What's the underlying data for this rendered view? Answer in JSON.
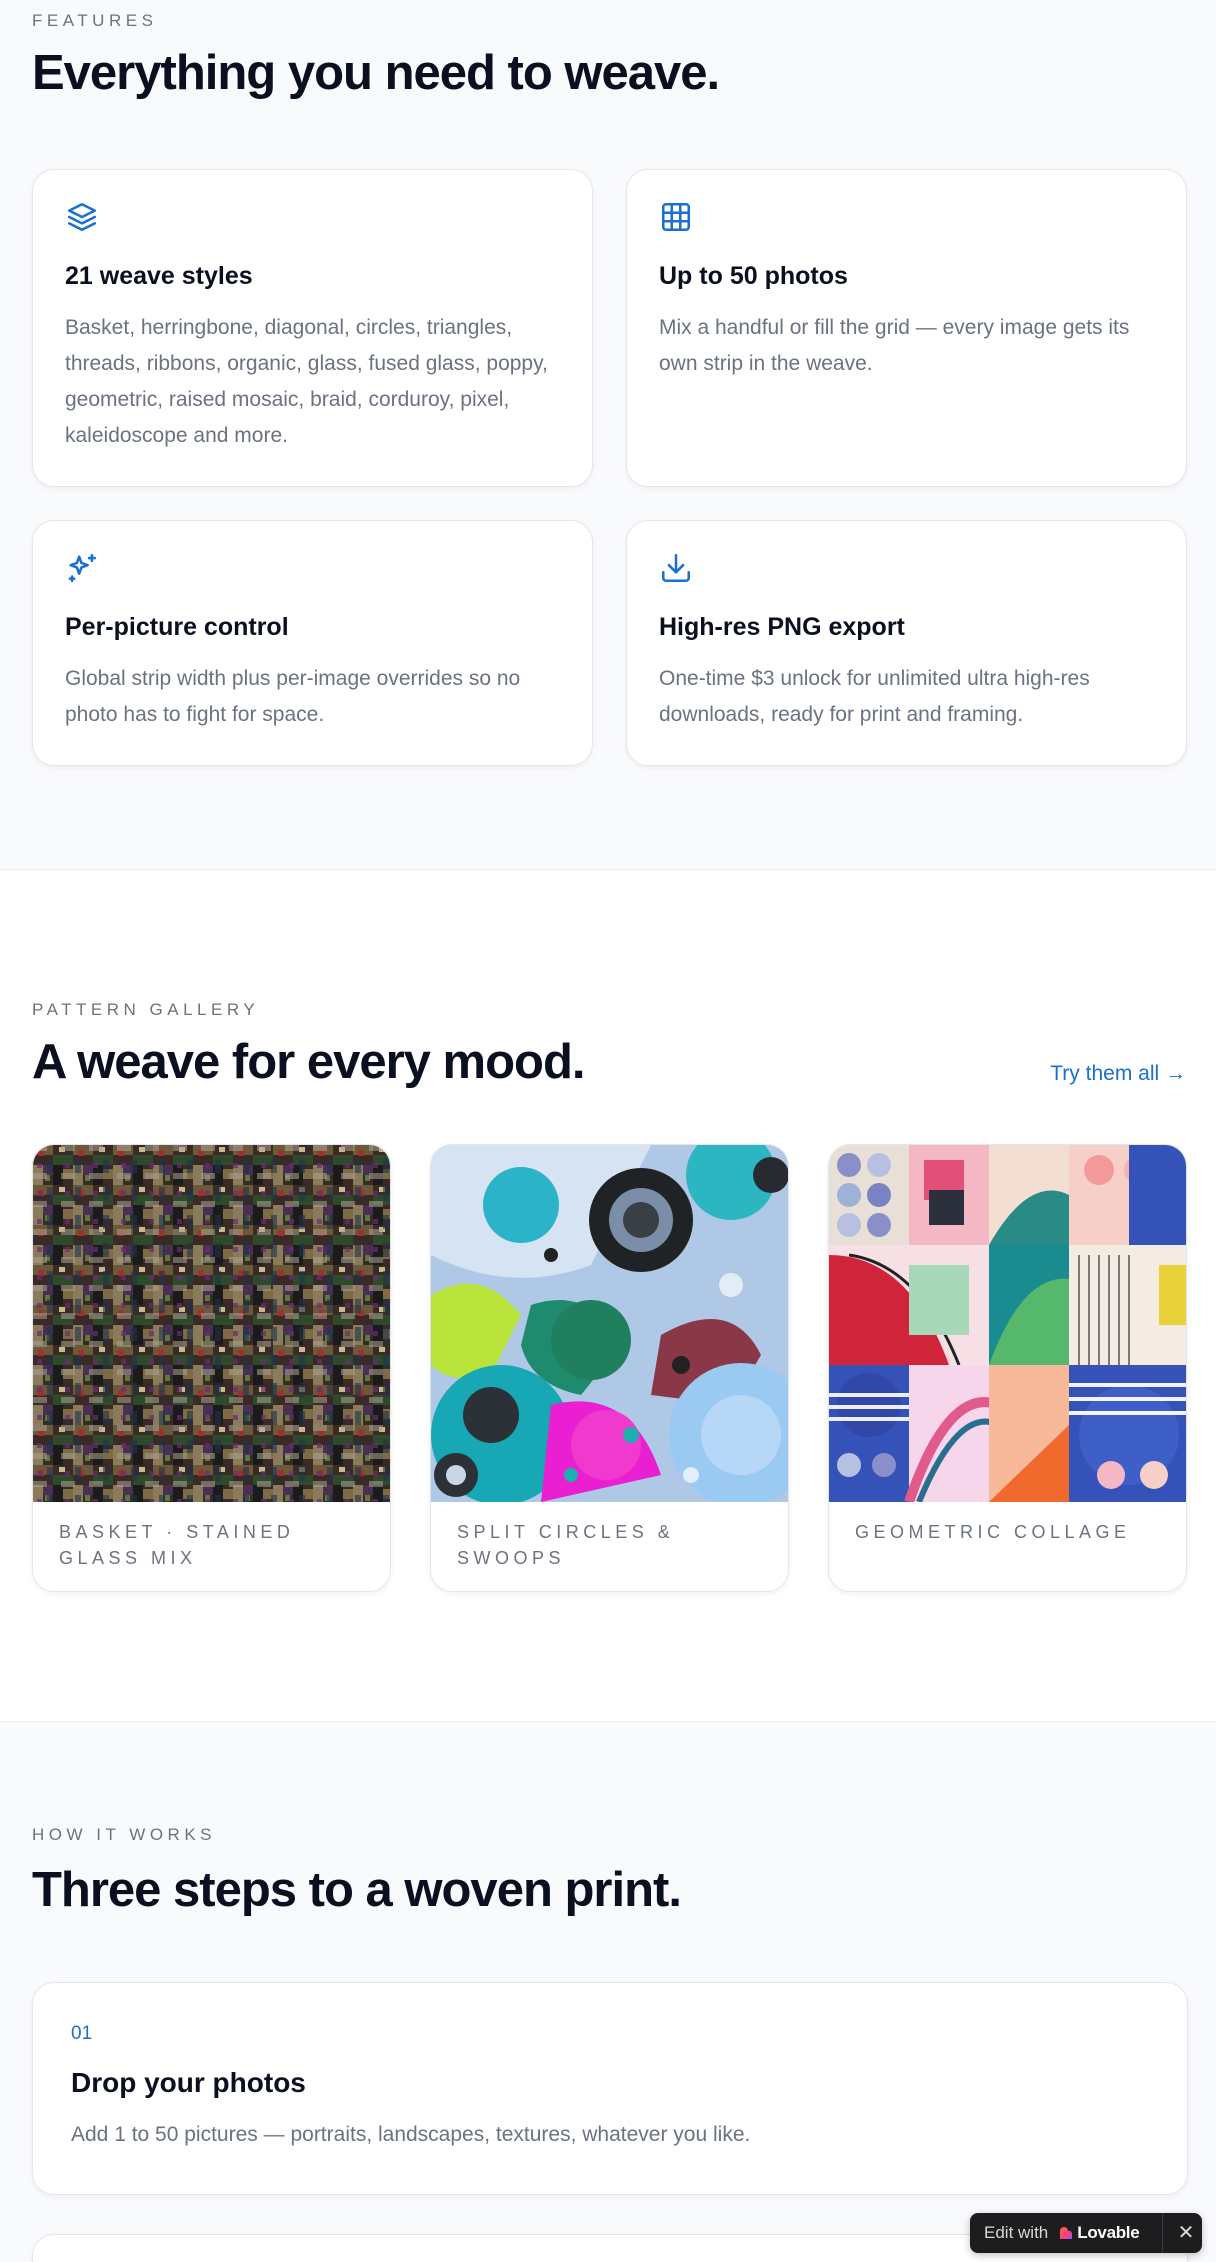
{
  "features": {
    "eyebrow": "FEATURES",
    "heading": "Everything you need to weave.",
    "items": [
      {
        "icon": "layers-icon",
        "title": "21 weave styles",
        "description": "Basket, herringbone, diagonal, circles, triangles, threads, ribbons, organic, glass, fused glass, poppy, geometric, raised mosaic, braid, corduroy, pixel, kaleidoscope and more."
      },
      {
        "icon": "grid-icon",
        "title": "Up to 50 photos",
        "description": "Mix a handful or fill the grid — every image gets its own strip in the weave."
      },
      {
        "icon": "sparkles-icon",
        "title": "Per-picture control",
        "description": "Global strip width plus per-image overrides so no photo has to fight for space."
      },
      {
        "icon": "download-icon",
        "title": "High-res PNG export",
        "description": "One-time $3 unlock for unlimited ultra high-res downloads, ready for print and framing."
      }
    ]
  },
  "gallery": {
    "eyebrow": "PATTERN GALLERY",
    "heading": "A weave for every mood.",
    "try_link": "Try them all →",
    "items": [
      {
        "caption": "BASKET · STAINED GLASS MIX"
      },
      {
        "caption": "SPLIT CIRCLES & SWOOPS"
      },
      {
        "caption": "GEOMETRIC COLLAGE"
      }
    ]
  },
  "how": {
    "eyebrow": "HOW IT WORKS",
    "heading": "Three steps to a woven print.",
    "steps": [
      {
        "number": "01",
        "title": "Drop your photos",
        "description": "Add 1 to 50 pictures — portraits, landscapes, textures, whatever you like."
      }
    ]
  },
  "badge": {
    "edit_label": "Edit with",
    "brand": "Lovable",
    "close": "✕"
  },
  "colors": {
    "accent": "#1a6fd1",
    "heading": "#0b1020",
    "muted": "#6b7280",
    "background_alt": "#f9fafc"
  }
}
